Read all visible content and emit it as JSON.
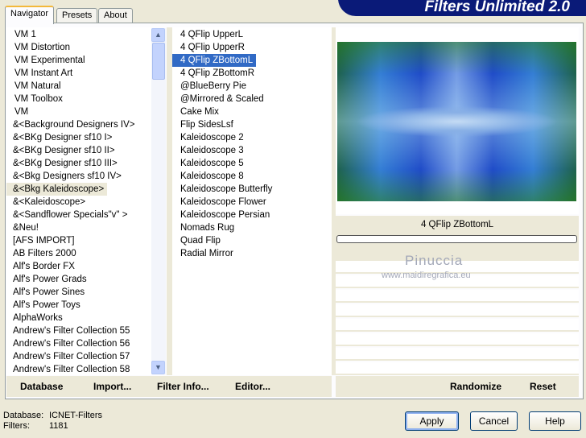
{
  "app": {
    "title": "Filters Unlimited 2.0"
  },
  "tabs": [
    {
      "label": "Navigator",
      "active": true
    },
    {
      "label": "Presets"
    },
    {
      "label": "About"
    }
  ],
  "categories": [
    "VM 1",
    "VM Distortion",
    "VM Experimental",
    "VM Instant Art",
    "VM Natural",
    "VM Toolbox",
    "VM",
    "&<Background Designers IV>",
    "&<BKg Designer sf10 I>",
    "&<BKg Designer sf10 II>",
    "&<BKg Designer sf10 III>",
    "&<Bkg Designers sf10 IV>",
    "&<Bkg Kaleidoscope>",
    "&<Kaleidoscope>",
    "&<Sandflower Specials\"v\" >",
    "&Neu!",
    "[AFS IMPORT]",
    "AB Filters 2000",
    "Alf's Border FX",
    "Alf's Power Grads",
    "Alf's Power Sines",
    "Alf's Power Toys",
    "AlphaWorks",
    "Andrew's Filter Collection 55",
    "Andrew's Filter Collection 56",
    "Andrew's Filter Collection 57",
    "Andrew's Filter Collection 58"
  ],
  "selected_category": "&<Bkg Kaleidoscope>",
  "filters": [
    "4 QFlip UpperL",
    "4 QFlip UpperR",
    "4 QFlip ZBottomL",
    "4 QFlip ZBottomR",
    "@BlueBerry Pie",
    "@Mirrored & Scaled",
    "Cake Mix",
    "Flip SidesLsf",
    "Kaleidoscope 2",
    "Kaleidoscope 3",
    "Kaleidoscope 5",
    "Kaleidoscope 8",
    "Kaleidoscope Butterfly",
    "Kaleidoscope Flower",
    "Kaleidoscope Persian",
    "Nomads Rug",
    "Quad Flip",
    "Radial Mirror"
  ],
  "selected_filter": "4 QFlip ZBottomL",
  "preview": {
    "filter_name": "4 QFlip ZBottomL",
    "progress": 0
  },
  "watermark": {
    "name": "Pinuccia",
    "url": "www.maidiregrafica.eu"
  },
  "left_buttons": {
    "database": "Database",
    "import": "Import...",
    "filter_info": "Filter Info...",
    "editor": "Editor..."
  },
  "right_buttons": {
    "randomize": "Randomize",
    "reset": "Reset"
  },
  "status": {
    "database_label": "Database:",
    "database_value": "ICNET-Filters",
    "filters_label": "Filters:",
    "filters_value": "1181"
  },
  "dialog_buttons": {
    "apply": "Apply",
    "cancel": "Cancel",
    "help": "Help"
  }
}
